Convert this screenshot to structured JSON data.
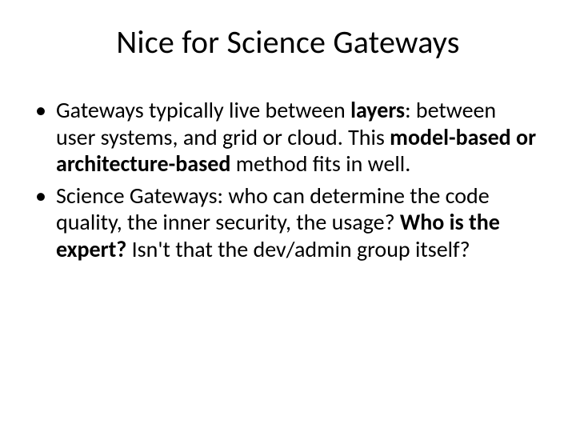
{
  "slide": {
    "title": "Nice for Science Gateways",
    "bullets": [
      {
        "t1": "Gateways typically live between ",
        "b1": "layers",
        "t2": ": between user systems, and grid or cloud. This ",
        "b2": "model-based or architecture-based",
        "t3": " method fits in well."
      },
      {
        "t1": "Science Gateways: who can determine the code quality, the inner security, the usage? ",
        "b1": "Who is the expert?",
        "t2": " Isn't that the dev/admin group itself?"
      }
    ]
  }
}
